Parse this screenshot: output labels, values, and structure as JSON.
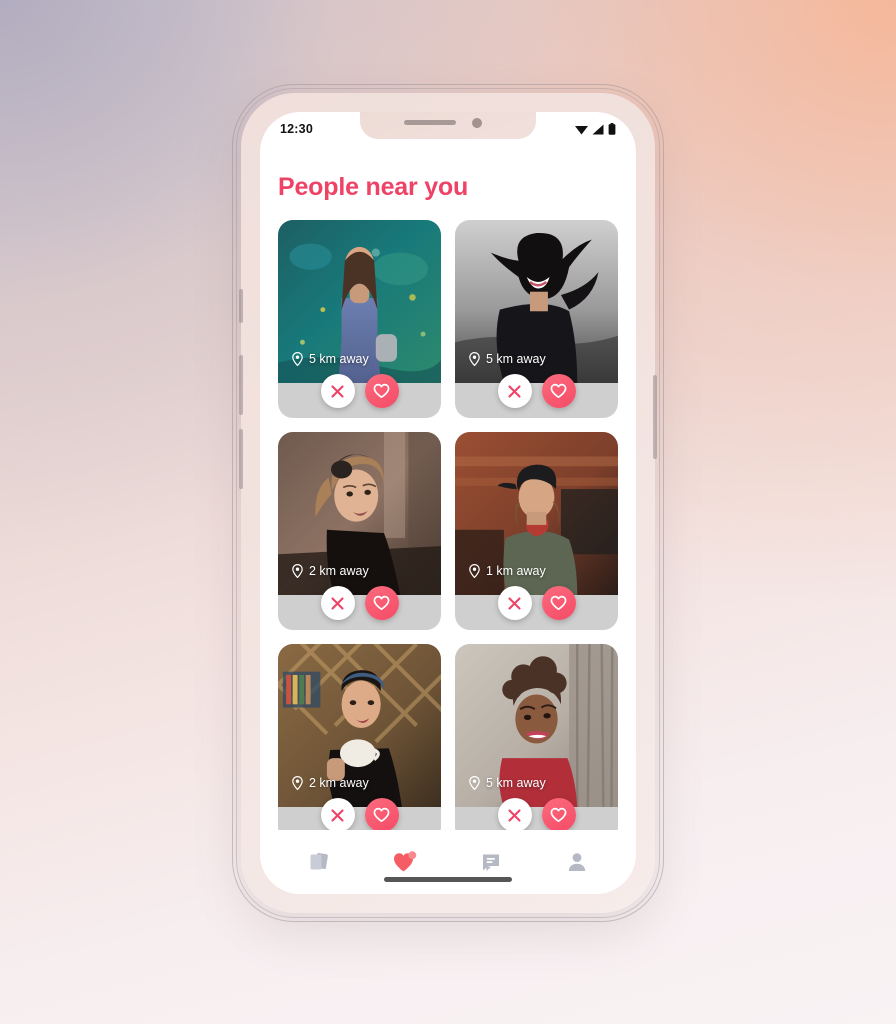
{
  "background": {
    "gradient_from": "#c9c2cf",
    "gradient_to": "#f7b798"
  },
  "device": {
    "frame_color": "#f2e2de",
    "side_buttons": [
      "mute-switch",
      "volume-up",
      "volume-down",
      "power"
    ]
  },
  "status_bar": {
    "time": "12:30",
    "icons": [
      "wifi-icon",
      "cellular-signal-icon",
      "battery-icon"
    ]
  },
  "header": {
    "title": "People near you",
    "title_color": "#ee4266"
  },
  "theme": {
    "accent": "#ee4266",
    "like_button": "#f54b66",
    "pass_button": "#ffffff",
    "nav_inactive": "#b5b9c4",
    "nav_active": "#f65c63"
  },
  "cards": [
    {
      "id": "person-1",
      "distance": "5 km away",
      "pin_icon": "location-pin-icon",
      "pass_icon": "close-icon",
      "like_icon": "heart-icon",
      "photo_desc": "woman in floral dress against teal painted wall"
    },
    {
      "id": "person-2",
      "distance": "5 km away",
      "pin_icon": "location-pin-icon",
      "pass_icon": "close-icon",
      "like_icon": "heart-icon",
      "photo_desc": "laughing woman with dark hair blowing in wind"
    },
    {
      "id": "person-3",
      "distance": "2 km away",
      "pin_icon": "location-pin-icon",
      "pass_icon": "close-icon",
      "like_icon": "heart-icon",
      "photo_desc": "woman with ponytail looking sideways in warm light"
    },
    {
      "id": "person-4",
      "distance": "1 km away",
      "pin_icon": "location-pin-icon",
      "pass_icon": "close-icon",
      "like_icon": "heart-icon",
      "photo_desc": "woman in cap and red scarf by brick wall"
    },
    {
      "id": "person-5",
      "distance": "2 km away",
      "pin_icon": "location-pin-icon",
      "pass_icon": "close-icon",
      "like_icon": "heart-icon",
      "photo_desc": "woman with headscarf holding coffee cup indoors"
    },
    {
      "id": "person-6",
      "distance": "5 km away",
      "pin_icon": "location-pin-icon",
      "pass_icon": "close-icon",
      "like_icon": "heart-icon",
      "photo_desc": "smiling woman with curly updo beside tree"
    }
  ],
  "bottom_nav": {
    "items": [
      {
        "name": "cards-stack-icon",
        "active": false
      },
      {
        "name": "heart-icon",
        "active": true,
        "badge": true
      },
      {
        "name": "chat-bubble-icon",
        "active": false
      },
      {
        "name": "profile-person-icon",
        "active": false
      }
    ]
  }
}
